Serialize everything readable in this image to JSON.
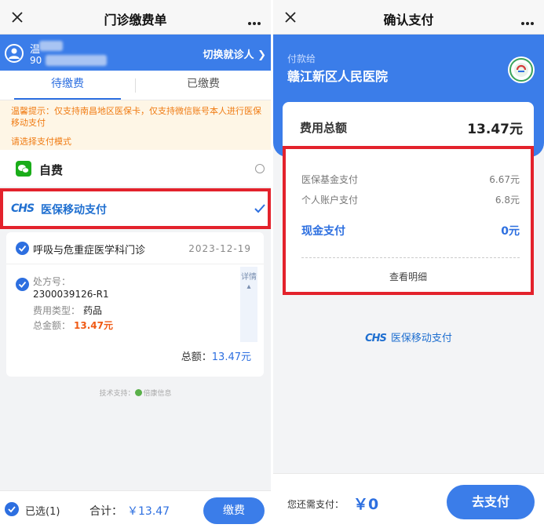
{
  "colors": {
    "primary": "#3b7de9",
    "highlight": "#e3222c",
    "warning": "#f07c14",
    "wechat": "#1aad19"
  },
  "left": {
    "title": "门诊缴费单",
    "patient": {
      "name_prefix": "温",
      "card_prefix": "90",
      "card_suffix": "4400",
      "switch_label": "切换就诊人"
    },
    "tabs": [
      {
        "label": "待缴费"
      },
      {
        "label": "已缴费"
      }
    ],
    "tip": {
      "text": "温馨提示：仅支持南昌地区医保卡，仅支持微信账号本人进行医保移动支付",
      "choose": "请选择支付模式"
    },
    "options": {
      "self_pay": "自费",
      "chs_logo": "CHS",
      "chs_pay": "医保移动支付"
    },
    "bill": {
      "department": "呼吸与危重症医学科门诊",
      "date": "2023-12-19",
      "prescription_label": "处方号：",
      "prescription_no": "2300039126-R1",
      "type_label": "费用类型：",
      "type_value": "药品",
      "amount_label": "总金额：",
      "amount_value": "13.47元",
      "detail_label": "详情",
      "total_label": "总额：",
      "total_value": "13.47元"
    },
    "tech_support": "技术支持：",
    "tech_brand": "倍康信息",
    "footer": {
      "selected": "已选(1)",
      "sum_label": "合计：",
      "sum_value": "￥13.47",
      "pay_button": "缴费"
    }
  },
  "right": {
    "title": "确认支付",
    "pay_to_label": "付款给",
    "hospital": "赣江新区人民医院",
    "total": {
      "label": "费用总额",
      "value": "13.47元"
    },
    "breakdown": [
      {
        "label": "医保基金支付",
        "value": "6.67元"
      },
      {
        "label": "个人账户支付",
        "value": "6.8元"
      },
      {
        "label": "现金支付",
        "value": "0元"
      }
    ],
    "detail_link": "查看明细",
    "chs_logo": "CHS",
    "chs_text": "医保移动支付",
    "footer": {
      "need_label": "您还需支付：",
      "need_value": "￥0",
      "go_button": "去支付"
    }
  }
}
